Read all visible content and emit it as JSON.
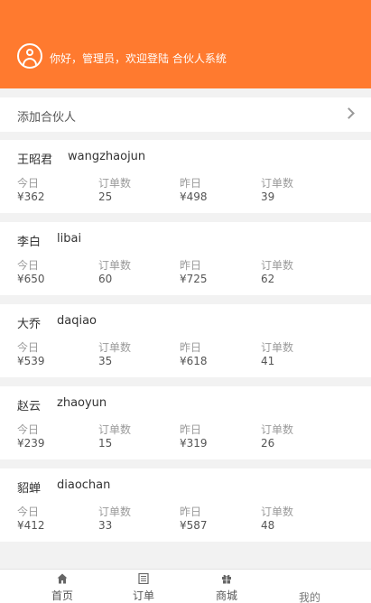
{
  "header": {
    "welcome": "你好，管理员，欢迎登陆 合伙人系统"
  },
  "add_partner": {
    "label": "添加合伙人"
  },
  "stat_labels": {
    "today": "今日",
    "orders": "订单数",
    "yesterday": "昨日",
    "orders2": "订单数"
  },
  "partners": [
    {
      "name": "王昭君",
      "pinyin": "wangzhaojun",
      "today": "¥362",
      "today_orders": "25",
      "yesterday": "¥498",
      "yesterday_orders": "39"
    },
    {
      "name": "李白",
      "pinyin": "libai",
      "today": "¥650",
      "today_orders": "60",
      "yesterday": "¥725",
      "yesterday_orders": "62"
    },
    {
      "name": "大乔",
      "pinyin": "daqiao",
      "today": "¥539",
      "today_orders": "35",
      "yesterday": "¥618",
      "yesterday_orders": "41"
    },
    {
      "name": "赵云",
      "pinyin": "zhaoyun",
      "today": "¥239",
      "today_orders": "15",
      "yesterday": "¥319",
      "yesterday_orders": "26"
    },
    {
      "name": "貂蝉",
      "pinyin": "diaochan",
      "today": "¥412",
      "today_orders": "33",
      "yesterday": "¥587",
      "yesterday_orders": "48"
    }
  ],
  "tabbar": {
    "home": "首页",
    "orders": "订单",
    "mall": "商城",
    "mine": "我的"
  },
  "colors": {
    "brand": "#ff7a2f"
  }
}
